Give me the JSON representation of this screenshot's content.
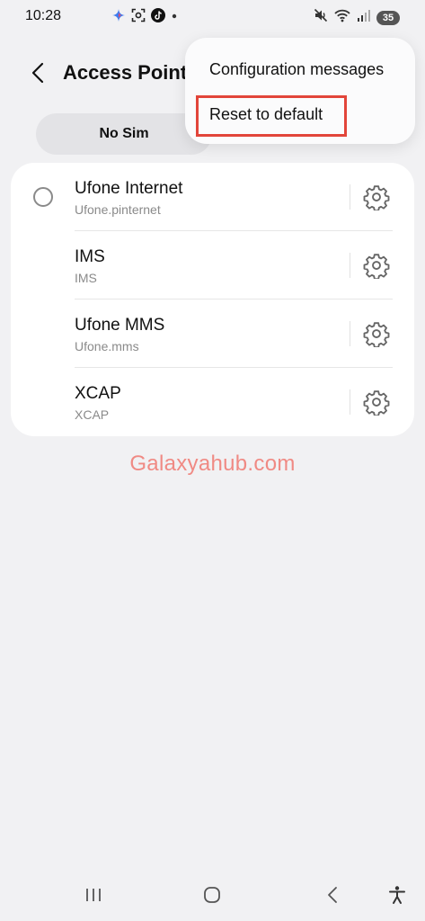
{
  "status_bar": {
    "time": "10:28",
    "battery": "35",
    "left_icons": [
      "gemini-sparkle-icon",
      "screenshot-icon",
      "tiktok-icon",
      "dot-icon"
    ],
    "right_icons": [
      "mute-icon",
      "wifi-icon",
      "signal-icon",
      "battery-icon"
    ]
  },
  "header": {
    "title": "Access Point Names",
    "back_icon": "chevron-left-icon"
  },
  "tabs": {
    "sim_label": "No Sim"
  },
  "menu": {
    "items": [
      {
        "label": "Configuration messages"
      },
      {
        "label": "Reset to default",
        "highlighted": true
      }
    ],
    "highlight_color": "#e2453a"
  },
  "apn_list": [
    {
      "name": "Ufone Internet",
      "apn": "Ufone.pinternet",
      "has_radio": true
    },
    {
      "name": "IMS",
      "apn": "IMS",
      "has_radio": false
    },
    {
      "name": "Ufone MMS",
      "apn": "Ufone.mms",
      "has_radio": false
    },
    {
      "name": "XCAP",
      "apn": "XCAP",
      "has_radio": false
    }
  ],
  "watermark": "Galaxyahub.com",
  "nav_bar": {
    "icons": [
      "recent-apps-icon",
      "home-icon",
      "back-icon",
      "accessibility-icon"
    ]
  },
  "colors": {
    "background": "#f1f1f3",
    "card": "#ffffff",
    "watermark": "#f08a84",
    "secondary_text": "#8a8a8a"
  }
}
